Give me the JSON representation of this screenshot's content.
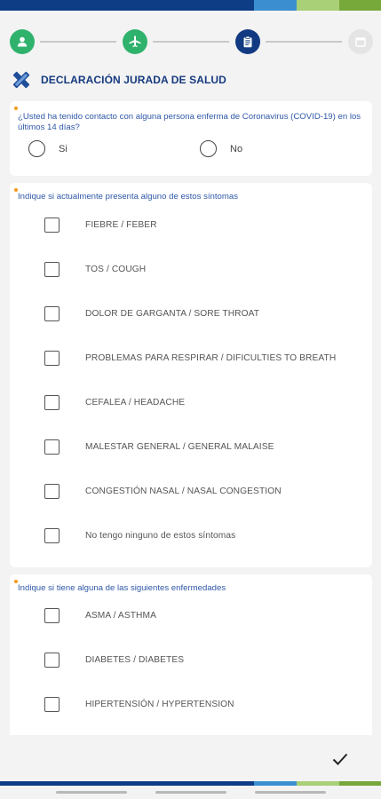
{
  "header": {
    "title": "DECLARACIÓN JURADA DE SALUD"
  },
  "stepper": {
    "steps": [
      {
        "icon": "person-icon",
        "state": "done"
      },
      {
        "icon": "airplane-icon",
        "state": "done"
      },
      {
        "icon": "clipboard-icon",
        "state": "active"
      },
      {
        "icon": "calendar-icon",
        "state": "pending"
      }
    ]
  },
  "contact_question": {
    "text": "¿Usted ha tenido contacto con alguna persona enferma de Coronavirus (COVID-19) en los últimos 14 días?",
    "options": [
      "Si",
      "No"
    ]
  },
  "symptoms": {
    "question": "Indique si actualmente presenta alguno de estos síntomas",
    "items": [
      "FIEBRE / FEBER",
      "TOS / COUGH",
      "DOLOR DE GARGANTA / SORE THROAT",
      "PROBLEMAS PARA RESPIRAR / DIFICULTIES TO BREATH",
      "CEFALEA / HEADACHE",
      "MALESTAR GENERAL / GENERAL MALAISE",
      "CONGESTIÓN NASAL / NASAL CONGESTION",
      "No tengo ninguno de estos síntomas"
    ]
  },
  "diseases": {
    "question": "Indique si tiene alguna de las siguientes enfermedades",
    "items": [
      "ASMA / ASTHMA",
      "DIABETES / DIABETES",
      "HIPERTENSIÓN / HYPERTENSION"
    ]
  },
  "colors": {
    "navy": "#123a82",
    "green": "#2fb26c",
    "accent_orange": "#f39a1e",
    "question_blue": "#2f58a8"
  }
}
